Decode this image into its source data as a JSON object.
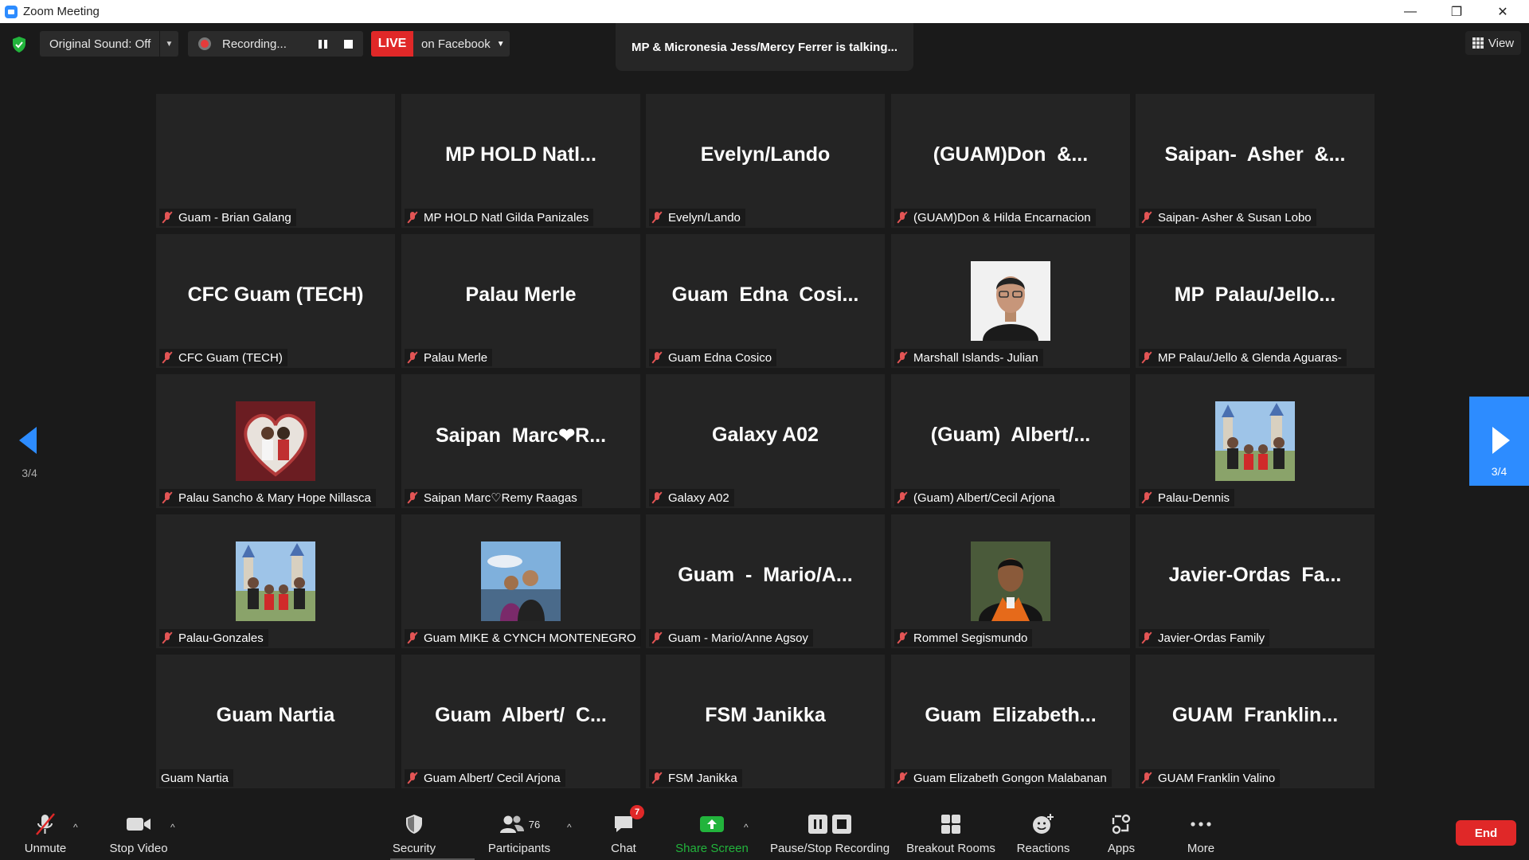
{
  "window": {
    "title": "Zoom Meeting",
    "controls": [
      "—",
      "❐",
      "✕"
    ]
  },
  "topbar": {
    "original_sound": "Original Sound: Off",
    "recording": "Recording...",
    "live_badge": "LIVE",
    "live_destination": "on Facebook",
    "talking": "MP & Micronesia Jess/Mercy Ferrer is talking...",
    "view": "View"
  },
  "pager": {
    "page": "3/4"
  },
  "tiles": [
    {
      "big": "",
      "name": "Guam - Brian Galang",
      "muted": true
    },
    {
      "big": "MP HOLD Natl...",
      "name": "MP HOLD Natl Gilda Panizales",
      "muted": true
    },
    {
      "big": "Evelyn/Lando",
      "name": "Evelyn/Lando",
      "muted": true
    },
    {
      "big": "(GUAM)Don  &...",
      "name": "(GUAM)Don & Hilda Encarnacion",
      "muted": true
    },
    {
      "big": "Saipan-  Asher  &...",
      "name": "Saipan- Asher & Susan Lobo",
      "muted": true
    },
    {
      "big": "CFC Guam (TECH)",
      "name": "CFC Guam (TECH)",
      "muted": true
    },
    {
      "big": "Palau Merle",
      "name": "Palau Merle",
      "muted": true
    },
    {
      "big": "Guam  Edna  Cosi...",
      "name": "Guam Edna Cosico",
      "muted": true
    },
    {
      "photo": "portrait-glasses",
      "name": "Marshall Islands- Julian",
      "muted": true
    },
    {
      "big": "MP  Palau/Jello...",
      "name": "MP Palau/Jello & Glenda Aguaras-",
      "muted": true
    },
    {
      "photo": "heart-couple",
      "name": "Palau Sancho & Mary Hope Nillasca",
      "muted": true
    },
    {
      "big": "Saipan  Marc❤R...",
      "name": "Saipan Marc♡Remy Raagas",
      "muted": true
    },
    {
      "big": "Galaxy A02",
      "name": "Galaxy A02",
      "muted": true
    },
    {
      "big": "(Guam)  Albert/...",
      "name": "(Guam) Albert/Cecil Arjona",
      "muted": true
    },
    {
      "photo": "family-castle",
      "name": "Palau-Dennis",
      "muted": true
    },
    {
      "photo": "family-castle",
      "name": "Palau-Gonzales",
      "muted": true
    },
    {
      "photo": "couple-sky",
      "name": "Guam MIKE & CYNCH MONTENEGRO",
      "muted": true
    },
    {
      "big": "Guam  -  Mario/A...",
      "name": "Guam - Mario/Anne Agsoy",
      "muted": true
    },
    {
      "photo": "graduation-portrait",
      "name": "Rommel Segismundo",
      "muted": true
    },
    {
      "big": "Javier-Ordas  Fa...",
      "name": "Javier-Ordas Family",
      "muted": true
    },
    {
      "big": "Guam Nartia",
      "name": "Guam Nartia",
      "muted": false
    },
    {
      "big": "Guam  Albert/  C...",
      "name": "Guam Albert/ Cecil Arjona",
      "muted": true
    },
    {
      "big": "FSM Janikka",
      "name": "FSM Janikka",
      "muted": true
    },
    {
      "big": "Guam  Elizabeth...",
      "name": "Guam Elizabeth Gongon Malabanan",
      "muted": true
    },
    {
      "big": "GUAM  Franklin...",
      "name": "GUAM Franklin Valino",
      "muted": true
    }
  ],
  "toolbar": {
    "unmute": "Unmute",
    "stop_video": "Stop Video",
    "security": "Security",
    "participants": "Participants",
    "participants_count": "76",
    "chat": "Chat",
    "chat_badge": "7",
    "share_screen": "Share Screen",
    "pause_stop_recording": "Pause/Stop Recording",
    "breakout_rooms": "Breakout Rooms",
    "reactions": "Reactions",
    "apps": "Apps",
    "more": "More",
    "end": "End"
  },
  "colors": {
    "accent": "#2d8cff",
    "danger": "#e02828",
    "share": "#22b43c",
    "background": "#1a1a1a",
    "tile": "#242424"
  }
}
